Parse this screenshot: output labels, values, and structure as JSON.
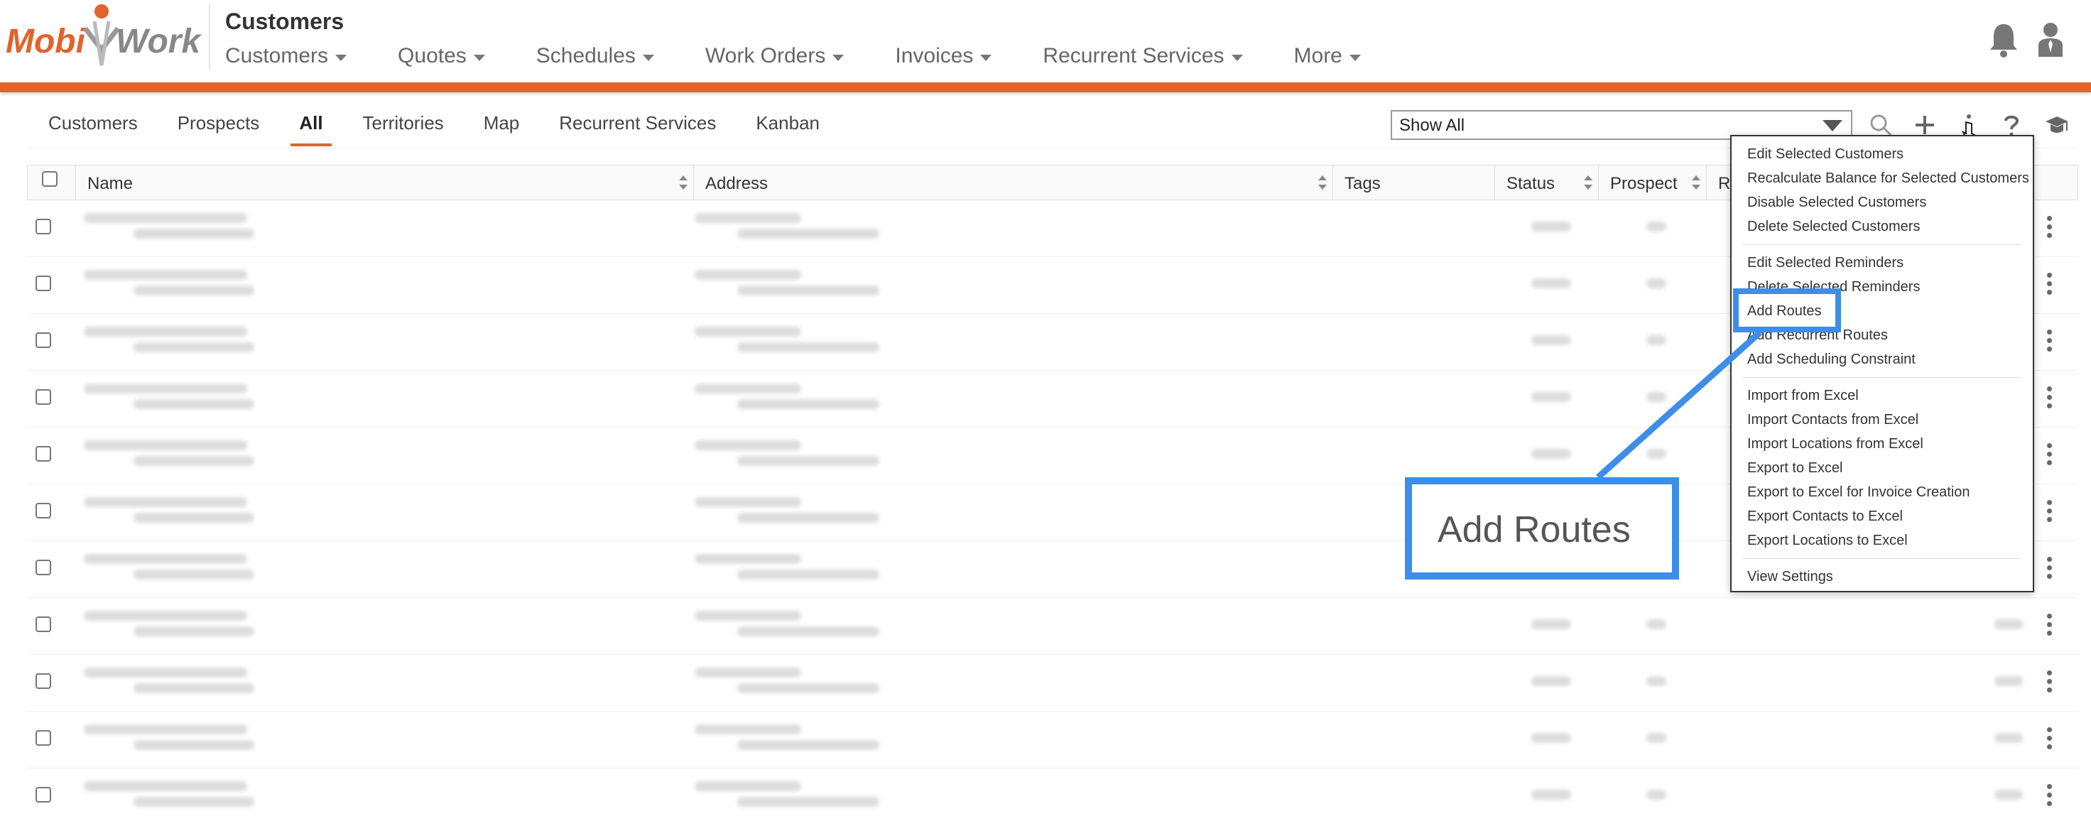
{
  "header": {
    "logo_text_left": "Mobi",
    "logo_text_right": "Work",
    "title": "Customers",
    "nav": [
      {
        "label": "Customers"
      },
      {
        "label": "Quotes"
      },
      {
        "label": "Schedules"
      },
      {
        "label": "Work Orders"
      },
      {
        "label": "Invoices"
      },
      {
        "label": "Recurrent Services"
      },
      {
        "label": "More"
      }
    ],
    "icons": [
      "bell-icon",
      "user-icon"
    ],
    "accent_color": "#e2632b"
  },
  "subtabs": [
    {
      "label": "Customers",
      "active": false
    },
    {
      "label": "Prospects",
      "active": false
    },
    {
      "label": "All",
      "active": true
    },
    {
      "label": "Territories",
      "active": false
    },
    {
      "label": "Map",
      "active": false
    },
    {
      "label": "Recurrent Services",
      "active": false
    },
    {
      "label": "Kanban",
      "active": false
    }
  ],
  "filter": {
    "selected": "Show All"
  },
  "toolbar_icons": [
    "search-icon",
    "plus-icon",
    "more-vertical-icon",
    "help-icon",
    "graduation-cap-icon"
  ],
  "table": {
    "columns": [
      "Name",
      "Address",
      "Tags",
      "Status",
      "Prospect",
      "Re"
    ],
    "row_count": 11
  },
  "menu": {
    "groups": [
      [
        "Edit Selected Customers",
        "Recalculate Balance for Selected Customers",
        "Disable Selected Customers",
        "Delete Selected Customers"
      ],
      [
        "Edit Selected Reminders",
        "Delete Selected Reminders",
        "Add Routes",
        "Add Recurrent Routes",
        "Add Scheduling Constraint"
      ],
      [
        "Import from Excel",
        "Import Contacts from Excel",
        "Import Locations from Excel",
        "Export to Excel",
        "Export to Excel for Invoice Creation",
        "Export Contacts to Excel",
        "Export Locations to Excel"
      ],
      [
        "View Settings"
      ]
    ]
  },
  "callout": {
    "label": "Add Routes",
    "color": "#3d8ee8"
  }
}
